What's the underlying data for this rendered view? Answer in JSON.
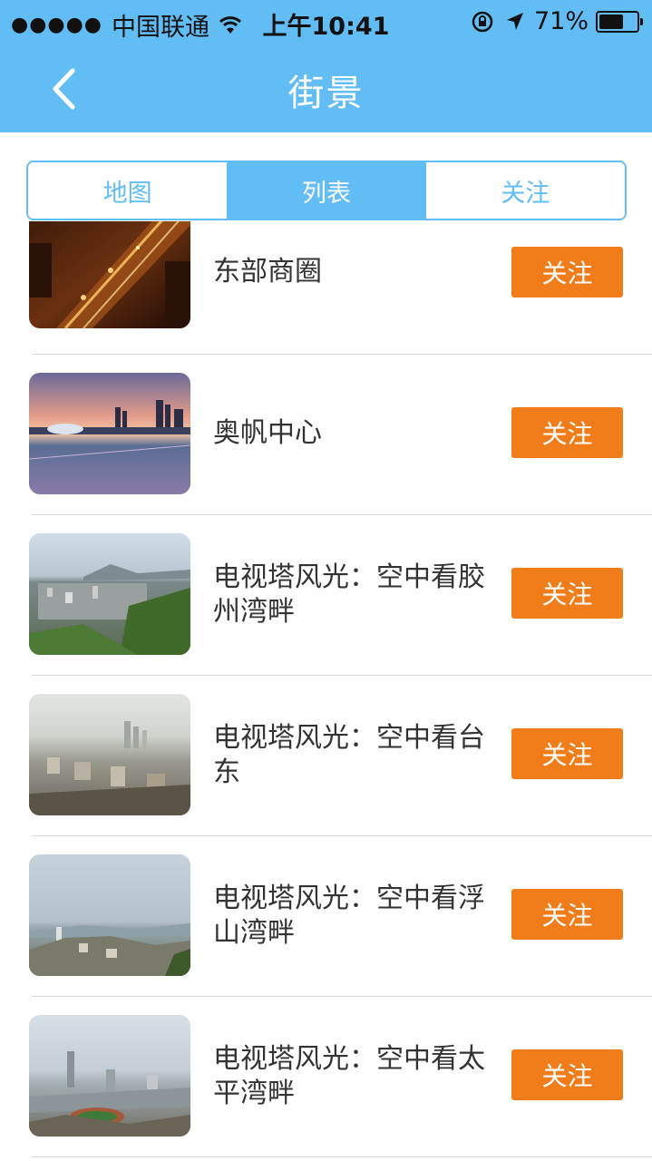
{
  "status": {
    "carrier": "中国联通",
    "time": "上午10:41",
    "battery_text": "71%",
    "battery_level": 0.71
  },
  "nav": {
    "title": "街景",
    "back_icon": "chevron-left-icon"
  },
  "tabs": [
    {
      "label": "地图",
      "active": false
    },
    {
      "label": "列表",
      "active": true
    },
    {
      "label": "关注",
      "active": false
    }
  ],
  "items": [
    {
      "title": "东部商圈",
      "button": "关注"
    },
    {
      "title": "奥帆中心",
      "button": "关注"
    },
    {
      "title": "电视塔风光：空中看胶州湾畔",
      "button": "关注"
    },
    {
      "title": "电视塔风光：空中看台东",
      "button": "关注"
    },
    {
      "title": "电视塔风光：空中看浮山湾畔",
      "button": "关注"
    },
    {
      "title": "电视塔风光：空中看太平湾畔",
      "button": "关注"
    }
  ],
  "colors": {
    "header": "#62bdf5",
    "accent": "#f07d1a"
  }
}
